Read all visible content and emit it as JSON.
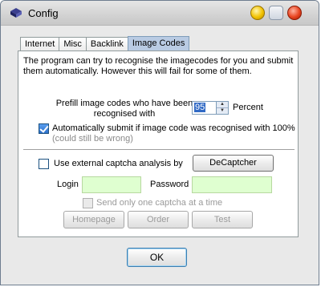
{
  "window": {
    "title": "Config"
  },
  "tabs": [
    {
      "label": "Internet"
    },
    {
      "label": "Misc"
    },
    {
      "label": "Backlink"
    },
    {
      "label": "Image Codes",
      "active": true
    }
  ],
  "image_codes": {
    "intro": "The program can try to recognise the imagecodes for you and submit them automatically. However this will fail for some of them.",
    "prefill_label": "Prefill image codes who have been recognised with",
    "prefill_value": "95",
    "percent_label": "Percent",
    "autosubmit": {
      "label": "Automatically submit if image code was recognised with 100%",
      "note": "(could still be wrong)",
      "checked": true
    },
    "external": {
      "label": "Use external captcha analysis by",
      "checked": false,
      "service_button": "DeCaptcher"
    },
    "login_label": "Login",
    "login_value": "",
    "password_label": "Password",
    "password_value": "",
    "one_captcha": {
      "label": "Send only one captcha at a time",
      "checked": false,
      "enabled": false
    },
    "buttons": {
      "homepage": "Homepage",
      "order": "Order",
      "test": "Test"
    }
  },
  "footer": {
    "ok_label": "OK"
  },
  "colors": {
    "active_tab": "#b9cbe3",
    "input_green": "#dfffd0",
    "check_blue": "#2b6fc9"
  }
}
